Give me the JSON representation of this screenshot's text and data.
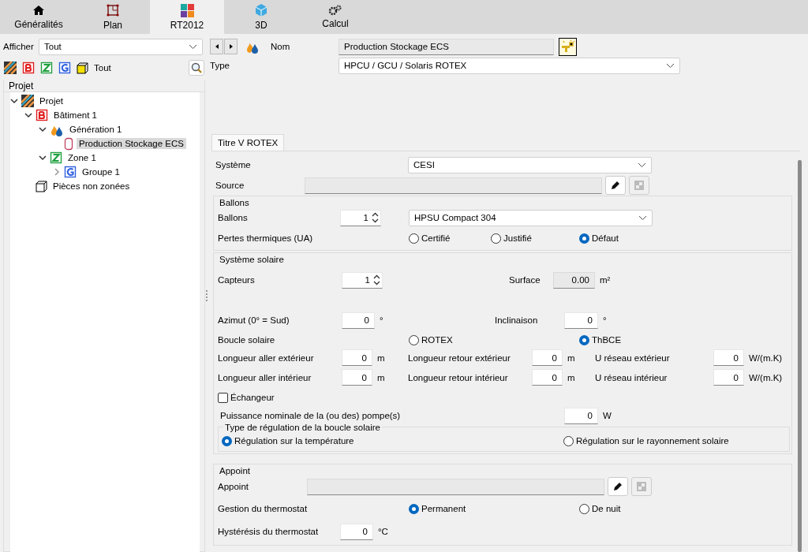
{
  "tabs": [
    {
      "label": "Généralités",
      "selected": false
    },
    {
      "label": "Plan",
      "selected": false
    },
    {
      "label": "RT2012",
      "selected": true
    },
    {
      "label": "3D",
      "selected": false
    },
    {
      "label": "Calcul",
      "selected": false
    }
  ],
  "filter": {
    "label": "Afficher",
    "value": "Tout"
  },
  "filter_toolbar": {
    "all_label": "Tout"
  },
  "tree": {
    "title": "Projet",
    "items": [
      {
        "label": "Projet",
        "kind": "project",
        "expanded": true,
        "selected": false,
        "children": [
          {
            "label": "Bâtiment 1",
            "kind": "building",
            "expanded": true,
            "selected": false,
            "children": [
              {
                "label": "Génération 1",
                "kind": "generation",
                "expanded": true,
                "selected": false,
                "children": [
                  {
                    "label": "Production Stockage ECS",
                    "kind": "storage",
                    "selected": true
                  }
                ]
              },
              {
                "label": "Zone 1",
                "kind": "zone",
                "expanded": true,
                "selected": false,
                "children": [
                  {
                    "label": "Groupe 1",
                    "kind": "group",
                    "expanded": false,
                    "selected": false
                  }
                ]
              }
            ]
          },
          {
            "label": "Pièces non zonées",
            "kind": "rooms",
            "selected": false
          }
        ]
      }
    ]
  },
  "header": {
    "name_label": "Nom",
    "name_value": "Production Stockage ECS",
    "type_label": "Type",
    "type_value": "HPCU / GCU / Solaris ROTEX"
  },
  "subtabs": [
    {
      "label": "Titre V ROTEX",
      "selected": true
    }
  ],
  "systeme": {
    "label": "Système",
    "value": "CESI"
  },
  "source": {
    "label": "Source"
  },
  "ballons": {
    "title": "Ballons",
    "count_label": "Ballons",
    "count": "1",
    "model": "HPSU Compact 304",
    "losses_label": "Pertes thermiques (UA)",
    "losses_options": [
      {
        "label": "Certifié",
        "selected": false
      },
      {
        "label": "Justifié",
        "selected": false
      },
      {
        "label": "Défaut",
        "selected": true
      }
    ]
  },
  "solaire": {
    "title": "Système solaire",
    "capteurs_label": "Capteurs",
    "capteurs": "1",
    "surface_label": "Surface",
    "surface": "0.00",
    "surface_unit": "m²",
    "azimut_label": "Azimut (0° = Sud)",
    "azimut": "0",
    "azimut_unit": "°",
    "inclinaison_label": "Inclinaison",
    "inclinaison": "0",
    "inclinaison_unit": "°",
    "boucle_label": "Boucle solaire",
    "boucle_options": [
      {
        "label": "ROTEX",
        "selected": false
      },
      {
        "label": "ThBCE",
        "selected": true
      }
    ],
    "lengths": [
      {
        "label": "Longueur aller extérieur",
        "value": "0",
        "unit": "m"
      },
      {
        "label": "Longueur retour extérieur",
        "value": "0",
        "unit": "m"
      },
      {
        "label": "U réseau extérieur",
        "value": "0",
        "unit": "W/(m.K)"
      },
      {
        "label": "Longueur aller intérieur",
        "value": "0",
        "unit": "m"
      },
      {
        "label": "Longueur retour intérieur",
        "value": "0",
        "unit": "m"
      },
      {
        "label": "U réseau intérieur",
        "value": "0",
        "unit": "W/(m.K)"
      }
    ],
    "echangeur": {
      "label": "Échangeur",
      "checked": false
    },
    "pompe": {
      "label": "Puissance nominale de la (ou des) pompe(s)",
      "value": "0",
      "unit": "W"
    },
    "regulation": {
      "title": "Type de régulation de la boucle solaire",
      "options": [
        {
          "label": "Régulation sur la température",
          "selected": true
        },
        {
          "label": "Régulation sur le rayonnement solaire",
          "selected": false
        }
      ]
    }
  },
  "appoint": {
    "title": "Appoint",
    "label": "Appoint",
    "thermostat_label": "Gestion du thermostat",
    "thermostat_options": [
      {
        "label": "Permanent",
        "selected": true
      },
      {
        "label": "De nuit",
        "selected": false
      }
    ],
    "hysteresis_label": "Hystérésis du thermostat",
    "hysteresis": "0",
    "hysteresis_unit": "°C"
  }
}
